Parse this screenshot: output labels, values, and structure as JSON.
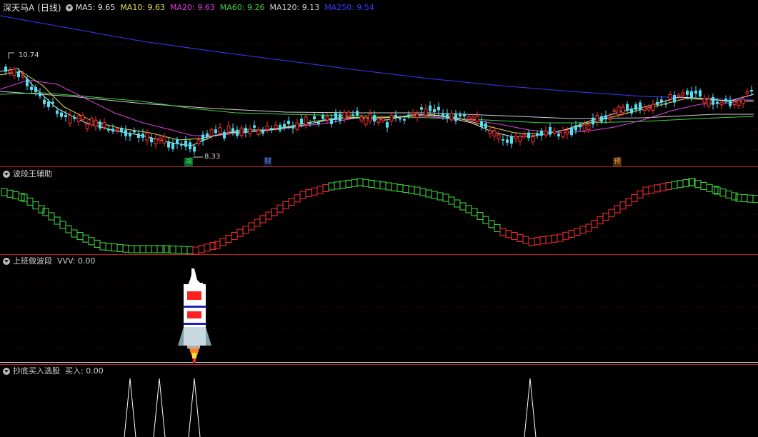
{
  "main_panel": {
    "stock_name": "深天马A",
    "period": "(日线)",
    "ma": [
      {
        "label": "MA5: 9.65",
        "color": "#e8e8e8"
      },
      {
        "label": "MA10: 9.63",
        "color": "#e8e050"
      },
      {
        "label": "MA20: 9.63",
        "color": "#e040e0"
      },
      {
        "label": "MA60: 9.26",
        "color": "#40d040"
      },
      {
        "label": "MA120: 9.13",
        "color": "#d0d0d0"
      },
      {
        "label": "MA250: 9.54",
        "color": "#3a3aff"
      }
    ],
    "high_label": "10.74",
    "low_label": "8.33",
    "markers": [
      {
        "text": "减",
        "color": "#40e040",
        "bg": "#063"
      },
      {
        "text": "财",
        "color": "#60a0ff",
        "bg": "#113"
      },
      {
        "text": "预",
        "color": "#ff9040",
        "bg": "#430"
      }
    ]
  },
  "panel2": {
    "title": "波段王辅助"
  },
  "panel3": {
    "title": "上班做波段",
    "value": "VVV: 0.00"
  },
  "panel4": {
    "title": "抄底买入选股",
    "value": "买入: 0.00"
  },
  "colors": {
    "up": "#ff3030",
    "down": "#50e0f0",
    "separator": "#c0202a",
    "grid": "#5a0000"
  }
}
